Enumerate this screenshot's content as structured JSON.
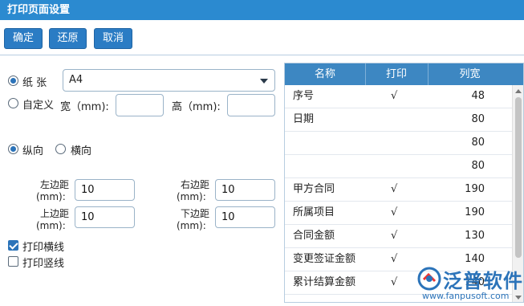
{
  "title": "打印页面设置",
  "toolbar": {
    "confirm": "确定",
    "restore": "还原",
    "cancel": "取消"
  },
  "paper": {
    "paper_label": "纸 张",
    "paper_value": "A4",
    "custom_label": "自定义",
    "width_label": "宽（mm):",
    "height_label": "高（mm):",
    "width_value": "",
    "height_value": ""
  },
  "orientation": {
    "portrait": "纵向",
    "landscape": "横向",
    "selected": "portrait"
  },
  "margins": {
    "left_label_1": "左边距",
    "left_label_2": "(mm):",
    "left_value": "10",
    "right_label_1": "右边距",
    "right_label_2": "(mm):",
    "right_value": "10",
    "top_label_1": "上边距",
    "top_label_2": "(mm):",
    "top_value": "10",
    "bottom_label_1": "下边距",
    "bottom_label_2": "(mm):",
    "bottom_value": "10"
  },
  "options": {
    "print_hlines": {
      "label": "打印横线",
      "checked": true
    },
    "print_vlines": {
      "label": "打印竖线",
      "checked": false
    }
  },
  "table": {
    "headers": [
      "名称",
      "打印",
      "列宽"
    ],
    "rows": [
      {
        "name": "序号",
        "print": "√",
        "width": "48"
      },
      {
        "name": "日期",
        "print": "",
        "width": "80"
      },
      {
        "name": "",
        "print": "",
        "width": "80"
      },
      {
        "name": "",
        "print": "",
        "width": "80"
      },
      {
        "name": "甲方合同",
        "print": "√",
        "width": "190"
      },
      {
        "name": "所属项目",
        "print": "√",
        "width": "190"
      },
      {
        "name": "合同金额",
        "print": "√",
        "width": "130"
      },
      {
        "name": "变更签证金额",
        "print": "√",
        "width": "140"
      },
      {
        "name": "累计结算金额",
        "print": "√",
        "width": "140"
      }
    ]
  },
  "watermark": {
    "brand": "泛普软件",
    "url": "www.fanpusoft.com"
  },
  "colors": {
    "titlebar": "#2b8ad0",
    "button": "#2b7cc4",
    "table_header": "#3d87c2"
  }
}
